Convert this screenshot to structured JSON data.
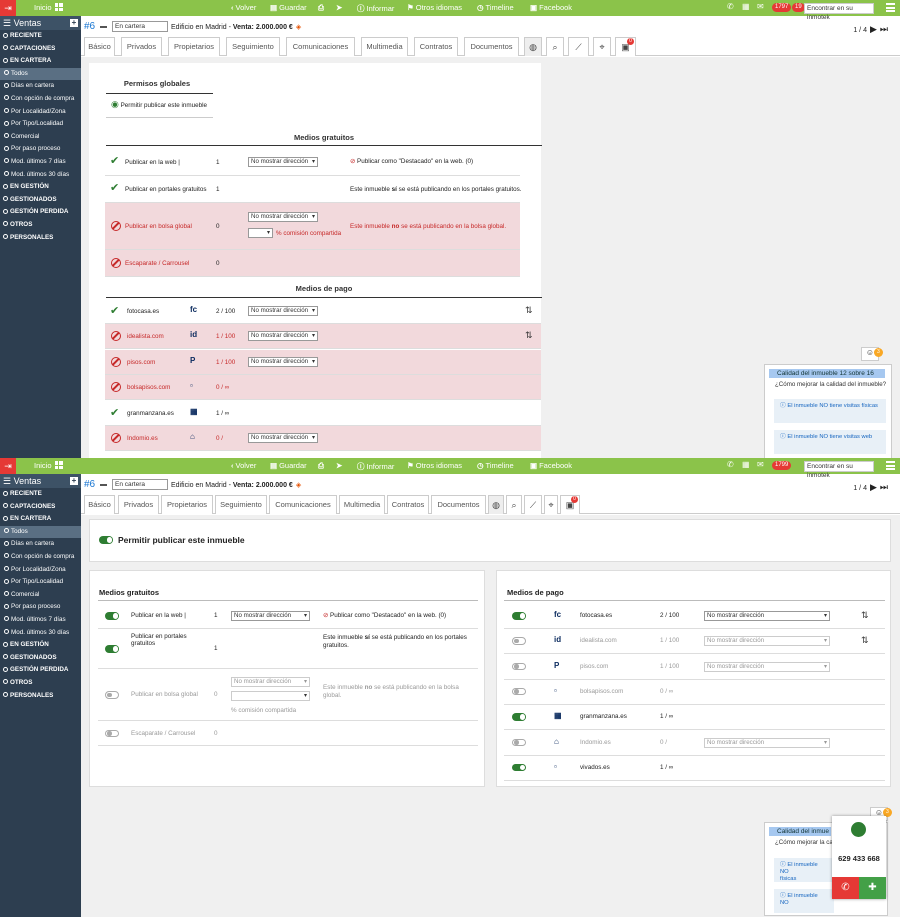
{
  "topbar": {
    "home": "Inicio",
    "nav": [
      {
        "icon": "‹",
        "label": "Volver"
      },
      {
        "icon": "▤",
        "label": "Guardar"
      },
      {
        "icon": "⎙",
        "label": ""
      },
      {
        "icon": "➤",
        "label": ""
      },
      {
        "icon": "ⓘ",
        "label": "Informar"
      },
      {
        "icon": "⚑",
        "label": "Otros idiomas"
      },
      {
        "icon": "◷",
        "label": "Timeline"
      },
      {
        "icon": "f",
        "label": "Facebook"
      }
    ],
    "badge_top_1": "1797",
    "badge_top_2": "19",
    "badge_bottom_1": "1799",
    "search_placeholder": "Encontrar en su inmotek"
  },
  "sidebar": {
    "title": "Ventas",
    "items": [
      {
        "label": "RECIENTE",
        "sub": false
      },
      {
        "label": "CAPTACIONES",
        "sub": false
      },
      {
        "label": "EN CARTERA",
        "sub": false
      },
      {
        "label": "Todos",
        "sub": true,
        "active": true
      },
      {
        "label": "Días en cartera",
        "sub": true
      },
      {
        "label": "Con opción de compra",
        "sub": true
      },
      {
        "label": "Por Localidad/Zona",
        "sub": true
      },
      {
        "label": "Por Tipo/Localidad",
        "sub": true
      },
      {
        "label": "Comercial",
        "sub": true
      },
      {
        "label": "Por paso proceso",
        "sub": true
      },
      {
        "label": "Mod. últimos 7 días",
        "sub": true
      },
      {
        "label": "Mod. últimos 30 días",
        "sub": true
      },
      {
        "label": "EN GESTIÓN",
        "sub": false
      },
      {
        "label": "GESTIONADOS",
        "sub": false
      },
      {
        "label": "GESTIÓN PERDIDA",
        "sub": false
      },
      {
        "label": "OTROS",
        "sub": false
      },
      {
        "label": "PERSONALES",
        "sub": false
      }
    ]
  },
  "header": {
    "id": "#6",
    "status": "En cartera",
    "title": "Edificio en Madrid -",
    "price": "Venta: 2.000.000 €",
    "pager": "1 / 4"
  },
  "tabs": [
    "Básico",
    "Privados",
    "Propietarios",
    "Seguimiento",
    "Comunicaciones",
    "Multimedia",
    "Contratos",
    "Documentos"
  ],
  "tab_badge": "0",
  "top": {
    "permisos_title": "Permisos globales",
    "permisos_label": "Permitir publicar este inmueble",
    "gratuitos_title": "Medios gratuitos",
    "pago_title": "Medios de pago",
    "gratuitos": [
      {
        "label": "Publicar en la web |",
        "num": "1",
        "select": "No mostrar dirección",
        "note": "Publicar como \"Destacado\" en la web. (0)",
        "ok": true
      },
      {
        "label": "Publicar en portales gratuitos",
        "num": "1",
        "note_pre": "Este inmueble",
        "note_bold": "sí",
        "note_post": "se está publicando en los portales gratuitos.",
        "ok": true
      },
      {
        "label": "Publicar en bolsa global",
        "num": "0",
        "select": "No mostrar dirección",
        "commission": "% comisión compartida",
        "note_pre": "Este inmueble",
        "note_bold": "no",
        "note_post": "se está publicando en la bolsa global.",
        "ok": false
      },
      {
        "label": "Escaparate / Carrousel",
        "num": "0",
        "ok": false
      }
    ],
    "pago": [
      {
        "label": "fotocasa.es",
        "logo": "fc",
        "num": "2 / 100",
        "select": "No mostrar dirección",
        "ok": true,
        "sort": true
      },
      {
        "label": "idealista.com",
        "logo": "id",
        "num": "1 / 100",
        "select": "No mostrar dirección",
        "ok": false,
        "sort": true
      },
      {
        "label": "pisos.com",
        "logo": "P",
        "num": "1 / 100",
        "select": "No mostrar dirección",
        "ok": false
      },
      {
        "label": "bolsapisos.com",
        "logo": "▫",
        "num": "0 / ∞",
        "ok": false
      },
      {
        "label": "granmanzana.es",
        "logo": "▦",
        "num": "1 / ∞",
        "ok": true
      },
      {
        "label": "Indomio.es",
        "logo": "⌂",
        "num": "0 /",
        "select": "No mostrar dirección",
        "ok": false
      },
      {
        "label": "vivados.es",
        "logo": "▫",
        "num": "1 / ∞",
        "ok": true
      }
    ]
  },
  "quality": {
    "title": "Calidad del inmueble 12 sobre 16",
    "title_short": "Calidad del inmue",
    "subtitle": "¿Cómo mejorar la calidad del inmueble?",
    "subtitle_short": "¿Cómo mejorar la ca",
    "items": [
      "El inmueble NO tiene visitas físicas",
      "El inmueble NO tiene visitas web"
    ],
    "items_short": [
      "El inmueble NO",
      "El inmueble NO"
    ],
    "items_short_2": [
      "físicas",
      ""
    ],
    "bot_badge": "3"
  },
  "bottom": {
    "permitir_label": "Permitir publicar este inmueble",
    "gratuitos_title": "Medios gratuitos",
    "pago_title": "Medios de pago",
    "phone": "629 433 668"
  },
  "colors": {
    "green": "#8bc34a",
    "sidebar": "#2d3e50",
    "danger": "#c62828",
    "toggle_on": "#2e7d32"
  }
}
